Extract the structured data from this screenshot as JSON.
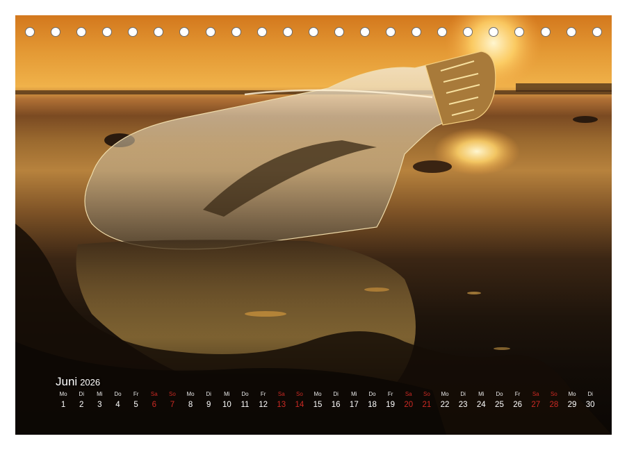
{
  "calendar": {
    "month": "Juni",
    "year": "2026",
    "days": [
      {
        "wd": "Mo",
        "d": "1",
        "we": false
      },
      {
        "wd": "Di",
        "d": "2",
        "we": false
      },
      {
        "wd": "Mi",
        "d": "3",
        "we": false
      },
      {
        "wd": "Do",
        "d": "4",
        "we": false
      },
      {
        "wd": "Fr",
        "d": "5",
        "we": false
      },
      {
        "wd": "Sa",
        "d": "6",
        "we": true
      },
      {
        "wd": "So",
        "d": "7",
        "we": true
      },
      {
        "wd": "Mo",
        "d": "8",
        "we": false
      },
      {
        "wd": "Di",
        "d": "9",
        "we": false
      },
      {
        "wd": "Mi",
        "d": "10",
        "we": false
      },
      {
        "wd": "Do",
        "d": "11",
        "we": false
      },
      {
        "wd": "Fr",
        "d": "12",
        "we": false
      },
      {
        "wd": "Sa",
        "d": "13",
        "we": true
      },
      {
        "wd": "So",
        "d": "14",
        "we": true
      },
      {
        "wd": "Mo",
        "d": "15",
        "we": false
      },
      {
        "wd": "Di",
        "d": "16",
        "we": false
      },
      {
        "wd": "Mi",
        "d": "17",
        "we": false
      },
      {
        "wd": "Do",
        "d": "18",
        "we": false
      },
      {
        "wd": "Fr",
        "d": "19",
        "we": false
      },
      {
        "wd": "Sa",
        "d": "20",
        "we": true
      },
      {
        "wd": "So",
        "d": "21",
        "we": true
      },
      {
        "wd": "Mo",
        "d": "22",
        "we": false
      },
      {
        "wd": "Di",
        "d": "23",
        "we": false
      },
      {
        "wd": "Mi",
        "d": "24",
        "we": false
      },
      {
        "wd": "Do",
        "d": "25",
        "we": false
      },
      {
        "wd": "Fr",
        "d": "26",
        "we": false
      },
      {
        "wd": "Sa",
        "d": "27",
        "we": true
      },
      {
        "wd": "So",
        "d": "28",
        "we": true
      },
      {
        "wd": "Mo",
        "d": "29",
        "we": false
      },
      {
        "wd": "Di",
        "d": "30",
        "we": false
      }
    ]
  },
  "colors": {
    "weekend": "#cc2a24",
    "weekday": "#ffffff",
    "sky": "#e49a35"
  },
  "binding_holes": 23
}
